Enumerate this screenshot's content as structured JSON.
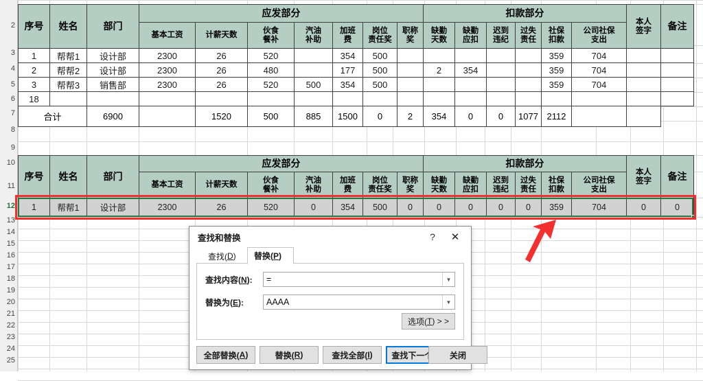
{
  "spreadsheet": {
    "row_headers": [
      "2",
      "3",
      "4",
      "5",
      "6",
      "7",
      "8",
      "9",
      "10",
      "11",
      "12",
      "13",
      "14",
      "15",
      "16",
      "17",
      "18",
      "19",
      "20",
      "21",
      "22",
      "23",
      "24",
      "25"
    ],
    "table1": {
      "group_headers": {
        "pay": "应发部分",
        "deduct": "扣款部分"
      },
      "columns": [
        {
          "key": "no",
          "label": "序号"
        },
        {
          "key": "name",
          "label": "姓名"
        },
        {
          "key": "dept",
          "label": "部门"
        },
        {
          "key": "base",
          "label": "基本工资"
        },
        {
          "key": "days",
          "label": "计薪天数"
        },
        {
          "key": "meal",
          "label": "伙食\n餐补",
          "l1": "伙食",
          "l2": "餐补"
        },
        {
          "key": "fuel",
          "label": "汽油\n补助",
          "l1": "汽油",
          "l2": "补助"
        },
        {
          "key": "ot",
          "label": "加班\n费",
          "l1": "加班",
          "l2": "费"
        },
        {
          "key": "post",
          "label": "岗位\n责任奖",
          "l1": "岗位",
          "l2": "责任奖"
        },
        {
          "key": "title",
          "label": "职称\n奖",
          "l1": "职称",
          "l2": "奖"
        },
        {
          "key": "absdays",
          "label": "缺勤\n天数",
          "l1": "缺勤",
          "l2": "天数"
        },
        {
          "key": "absded",
          "label": "缺勤\n应扣",
          "l1": "缺勤",
          "l2": "应扣"
        },
        {
          "key": "late",
          "label": "迟到\n违纪",
          "l1": "迟到",
          "l2": "违纪"
        },
        {
          "key": "fault",
          "label": "过失\n责任",
          "l1": "过失",
          "l2": "责任"
        },
        {
          "key": "si",
          "label": "社保\n扣款",
          "l1": "社保",
          "l2": "扣款"
        },
        {
          "key": "sicorp",
          "label": "公司社保\n支出",
          "l1": "公司社保",
          "l2": "支出"
        },
        {
          "key": "sign",
          "label": "本人\n签字",
          "l1": "本人",
          "l2": "签字"
        },
        {
          "key": "note",
          "label": "备注"
        }
      ],
      "rows": [
        [
          "1",
          "帮帮1",
          "设计部",
          "2300",
          "26",
          "520",
          "",
          "354",
          "500",
          "",
          "",
          "",
          "",
          "",
          "359",
          "704",
          "",
          ""
        ],
        [
          "2",
          "帮帮2",
          "设计部",
          "2300",
          "26",
          "480",
          "",
          "177",
          "500",
          "",
          "2",
          "354",
          "",
          "",
          "359",
          "704",
          "",
          ""
        ],
        [
          "3",
          "帮帮3",
          "销售部",
          "2300",
          "26",
          "520",
          "500",
          "354",
          "500",
          "",
          "",
          "",
          "",
          "",
          "359",
          "704",
          "",
          ""
        ],
        [
          "18",
          "",
          "",
          "",
          "",
          "",
          "",
          "",
          "",
          "",
          "",
          "",
          "",
          "",
          "",
          "",
          "",
          ""
        ]
      ],
      "total_label": "合计",
      "total_row": [
        "6900",
        "",
        "1520",
        "500",
        "885",
        "1500",
        "0",
        "2",
        "354",
        "0",
        "0",
        "1077",
        "2112",
        "",
        ""
      ]
    },
    "table2": {
      "group_headers": {
        "pay": "应发部分",
        "deduct": "扣款部分"
      },
      "selected_row": [
        "1",
        "帮帮1",
        "设计部",
        "2300",
        "26",
        "520",
        "0",
        "354",
        "500",
        "0",
        "0",
        "0",
        "0",
        "0",
        "359",
        "704",
        "0",
        "0"
      ]
    }
  },
  "dialog": {
    "title": "查找和替换",
    "help_icon": "?",
    "close_icon": "✕",
    "tabs": [
      {
        "label": "查找(D)",
        "text": "查找(",
        "accel": "D",
        "tail": ")",
        "active": false
      },
      {
        "label": "替换(P)",
        "text": "替换(",
        "accel": "P",
        "tail": ")",
        "active": true
      }
    ],
    "fields": [
      {
        "label_text": "查找内容(",
        "accel": "N",
        "label_tail": "):",
        "value": "=",
        "placeholder": ""
      },
      {
        "label_text": "替换为(",
        "accel": "E",
        "label_tail": "):",
        "value": "AAAA",
        "placeholder": ""
      }
    ],
    "options_button": {
      "text": "选项(",
      "accel": "T",
      "tail": ") > >"
    },
    "buttons": [
      {
        "text": "全部替换(",
        "accel": "A",
        "tail": ")",
        "default": false
      },
      {
        "text": "替换(",
        "accel": "R",
        "tail": ")",
        "default": false
      },
      {
        "text": "查找全部(",
        "accel": "I",
        "tail": ")",
        "default": false
      },
      {
        "text": "查找下一个(",
        "accel": "F",
        "tail": ")",
        "default": true
      },
      {
        "text": "关闭",
        "accel": "",
        "tail": "",
        "default": false
      }
    ]
  },
  "colors": {
    "header_fill": "#b4cec4",
    "selection_green": "#1f7a43",
    "annotation_red": "#f2302f",
    "selected_row_fill": "#d2d2d2",
    "default_button_border": "#0078d7"
  }
}
